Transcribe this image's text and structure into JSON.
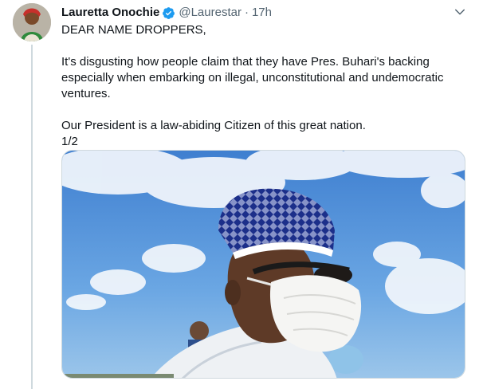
{
  "tweet": {
    "author": {
      "display_name": "Lauretta Onochie",
      "handle": "@Laurestar",
      "verified": true,
      "avatar_icon": "user-avatar"
    },
    "separator": "·",
    "time": "17h",
    "menu_icon": "chevron-down-icon",
    "body": {
      "line1": "DEAR NAME DROPPERS,",
      "line2": "It's disgusting how people claim that  they have Pres. Buhari's backing",
      "line3": "especially when embarking on illegal, unconstitutional and undemocratic",
      "line4": "ventures.",
      "line5": "Our President is a law-abiding Citizen of this great nation.",
      "line6": "1/2"
    },
    "media": {
      "type": "photo",
      "subject": "man-in-cap-and-face-mask"
    }
  },
  "colors": {
    "text_primary": "#0f1419",
    "text_secondary": "#536471",
    "verified_blue": "#1d9bf0",
    "thread_line": "#cfd9de"
  }
}
